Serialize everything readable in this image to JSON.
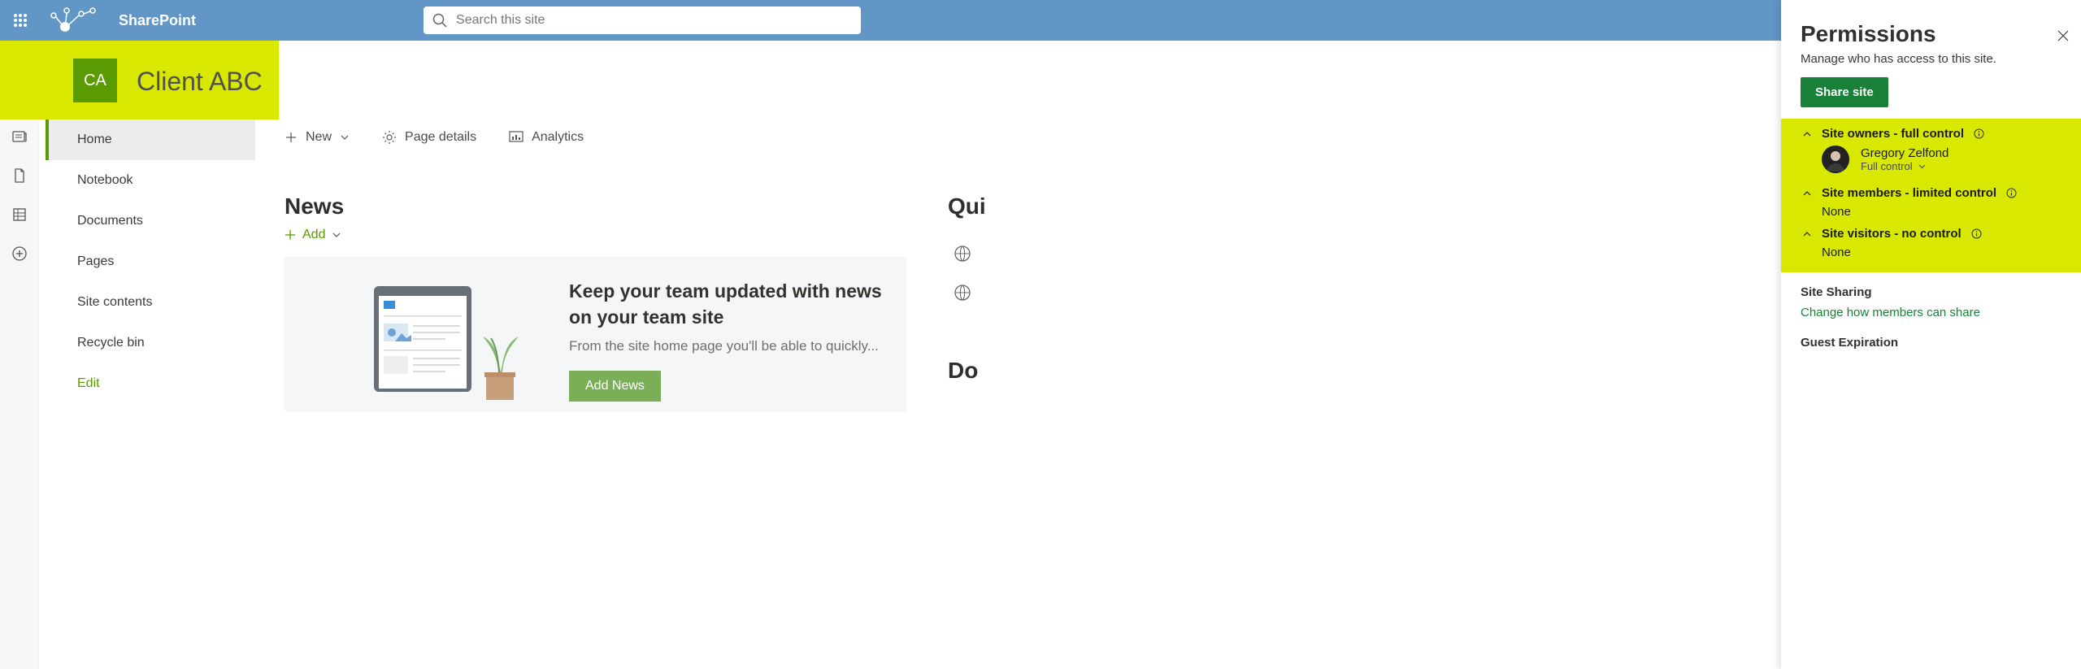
{
  "header": {
    "app_name": "SharePoint",
    "search_placeholder": "Search this site"
  },
  "site": {
    "logo_text": "CA",
    "title": "Client ABC"
  },
  "quicklaunch": [
    "Home",
    "Notebook",
    "Documents",
    "Pages",
    "Site contents",
    "Recycle bin"
  ],
  "quicklaunch_edit": "Edit",
  "cmdbar": {
    "new": "New",
    "page_details": "Page details",
    "analytics": "Analytics"
  },
  "news": {
    "title": "News",
    "add": "Add",
    "card_heading": "Keep your team updated with news on your team site",
    "card_sub": "From the site home page you'll be able to quickly...",
    "button": "Add News"
  },
  "right_column": {
    "quick_links": "Qui",
    "documents": "Do"
  },
  "panel": {
    "title": "Permissions",
    "subtitle": "Manage who has access to this site.",
    "share": "Share site",
    "owners_label": "Site owners - full control",
    "owner_name": "Gregory Zelfond",
    "owner_perm": "Full control",
    "members_label": "Site members - limited control",
    "members_body": "None",
    "visitors_label": "Site visitors - no control",
    "visitors_body": "None",
    "site_sharing": "Site Sharing",
    "change_link": "Change how members can share",
    "guest_exp": "Guest Expiration"
  }
}
